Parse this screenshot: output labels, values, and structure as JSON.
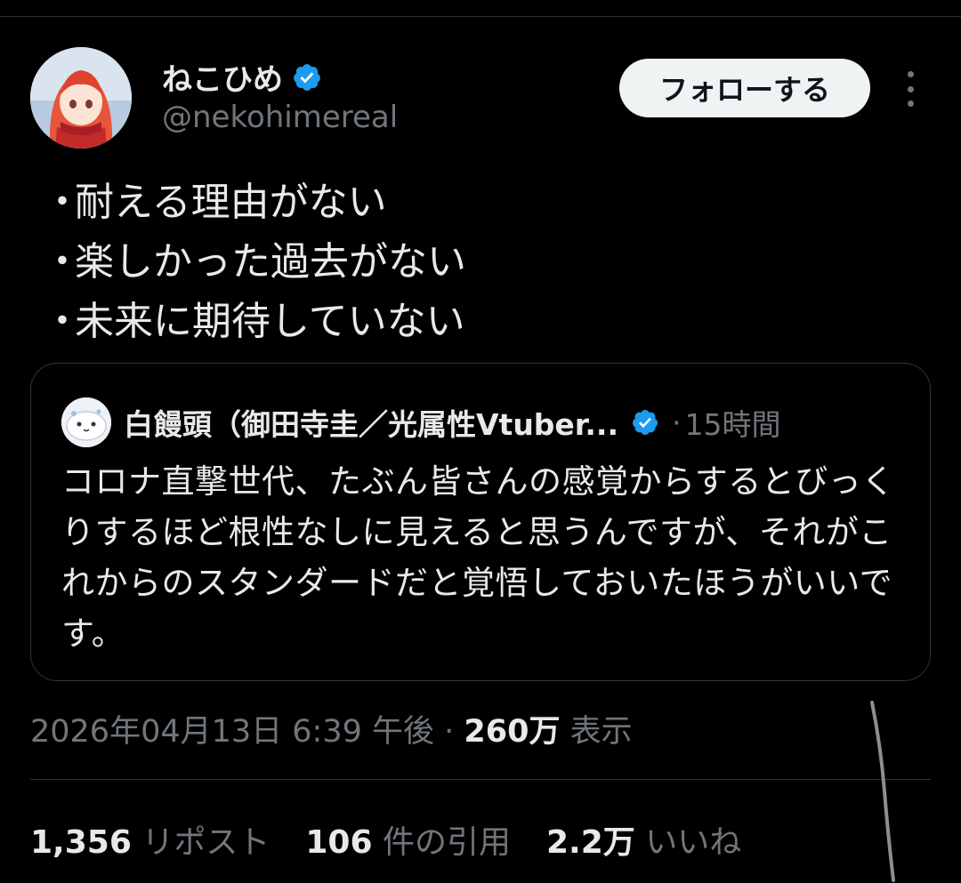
{
  "author": {
    "display_name": "ねこひめ",
    "handle": "@nekohimereal",
    "verified_icon": "verified-badge-icon"
  },
  "follow_button_label": "フォローする",
  "more_icon": "more-options-icon",
  "tweet_lines": [
    "耐える理由がない",
    "楽しかった過去がない",
    "未来に期待していない"
  ],
  "bullet": "・",
  "quote": {
    "display_name": "白饅頭（御田寺圭／光属性Vtuber...",
    "separator": "·",
    "time": "15時間",
    "text": "コロナ直撃世代、たぶん皆さんの感覚からするとびっくりするほど根性なしに見えると思うんですが、それがこれからのスタンダードだと覚悟しておいたほうがいいです。"
  },
  "meta": {
    "date_time": "2026年04月13日 6:39 午後",
    "separator": "·",
    "views_count": "260万",
    "views_label": "表示"
  },
  "stats": {
    "reposts_count": "1,356",
    "reposts_label": "リポスト",
    "quotes_count": "106",
    "quotes_label": "件の引用",
    "likes_count": "2.2万",
    "likes_label": "いいね"
  },
  "colors": {
    "background": "#000000",
    "text_primary": "#e7e9ea",
    "text_secondary": "#71767b",
    "verified_blue": "#1d9bf0",
    "divider": "#2f3336",
    "follow_button_bg": "#eff3f4"
  }
}
